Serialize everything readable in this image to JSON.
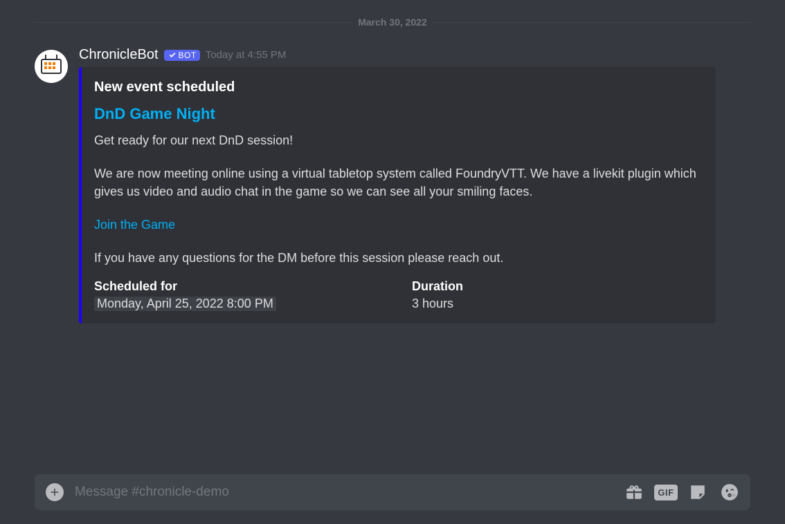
{
  "divider": {
    "date": "March 30, 2022"
  },
  "message": {
    "author": "ChronicleBot",
    "bot_label": "BOT",
    "timestamp": "Today at 4:55 PM"
  },
  "embed": {
    "title": "New event scheduled",
    "event_title": "DnD Game Night",
    "para1": "Get ready for our next DnD session!",
    "para2": "We are now meeting online using a virtual tabletop system called FoundryVTT. We have a livekit plugin which gives us video and audio chat in the game so we can see all your smiling faces.",
    "link_text": "Join the Game",
    "para3": "If you have any questions for the DM before this session please reach out.",
    "fields": {
      "scheduled_label": "Scheduled for",
      "scheduled_value": "Monday, April 25, 2022 8:00 PM",
      "duration_label": "Duration",
      "duration_value": "3 hours"
    }
  },
  "input": {
    "placeholder": "Message #chronicle-demo",
    "gif_label": "GIF"
  }
}
